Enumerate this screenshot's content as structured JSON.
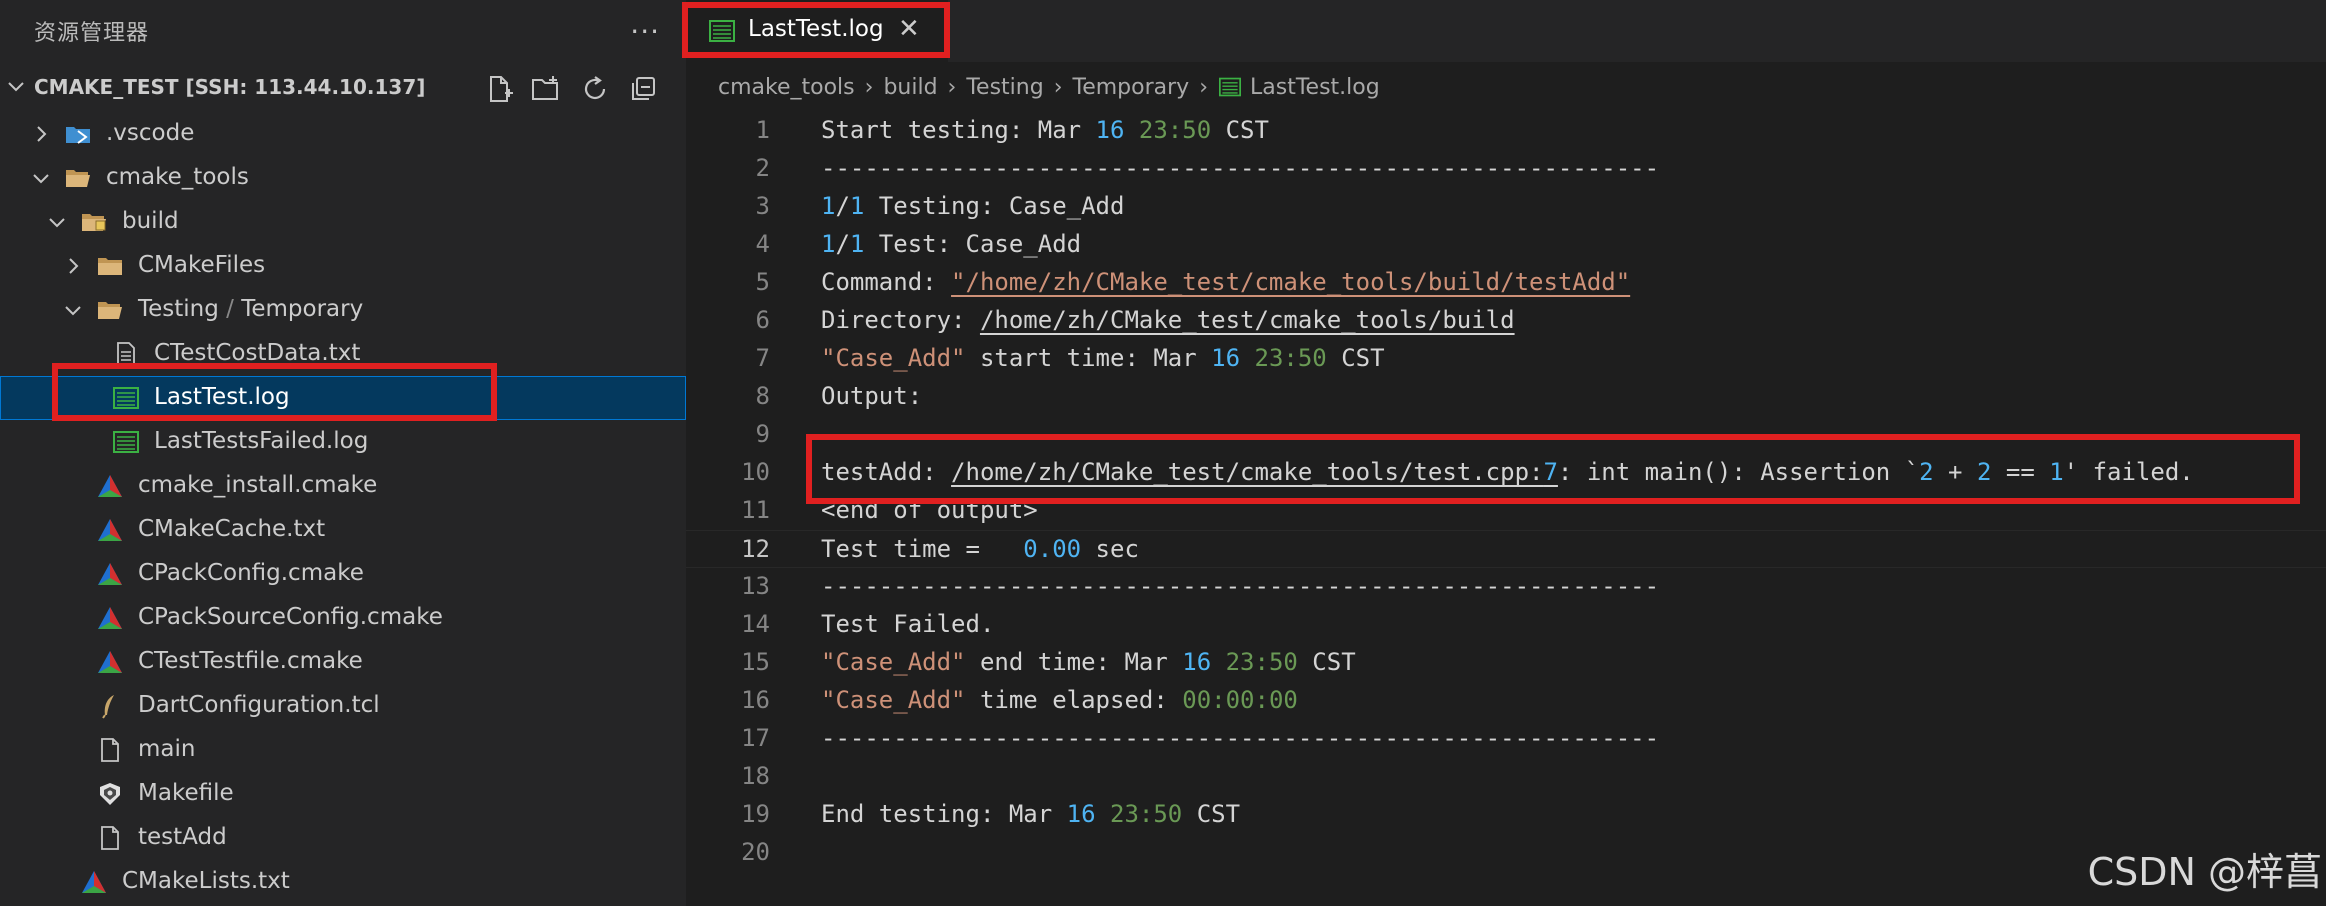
{
  "explorer": {
    "title": "资源管理器",
    "more": "···",
    "workspace": "CMAKE_TEST [SSH: 113.44.10.137]",
    "tree": [
      {
        "label": ".vscode"
      },
      {
        "label": "cmake_tools"
      },
      {
        "label": "build"
      },
      {
        "label": "CMakeFiles"
      },
      {
        "label_a": "Testing",
        "label_b": "Temporary"
      },
      {
        "label": "CTestCostData.txt"
      },
      {
        "label": "LastTest.log"
      },
      {
        "label": "LastTestsFailed.log"
      },
      {
        "label": "cmake_install.cmake"
      },
      {
        "label": "CMakeCache.txt"
      },
      {
        "label": "CPackConfig.cmake"
      },
      {
        "label": "CPackSourceConfig.cmake"
      },
      {
        "label": "CTestTestfile.cmake"
      },
      {
        "label": "DartConfiguration.tcl"
      },
      {
        "label": "main"
      },
      {
        "label": "Makefile"
      },
      {
        "label": "testAdd"
      },
      {
        "label": "CMakeLists.txt"
      }
    ]
  },
  "tab": {
    "label": "LastTest.log",
    "close": "✕"
  },
  "breadcrumb": [
    "cmake_tools",
    "build",
    "Testing",
    "Temporary",
    "LastTest.log"
  ],
  "editor": {
    "line_numbers": [
      "1",
      "2",
      "3",
      "4",
      "5",
      "6",
      "7",
      "8",
      "9",
      "10",
      "11",
      "12",
      "13",
      "14",
      "15",
      "16",
      "17",
      "18",
      "19",
      "20"
    ],
    "l1": {
      "a": "Start testing: Mar ",
      "b": "16",
      "c": " ",
      "d": "23:50",
      "e": " CST"
    },
    "dashes": "----------------------------------------------------------",
    "l3": {
      "a": "1",
      "b": "/",
      "c": "1",
      "d": " Testing: Case_Add"
    },
    "l4": {
      "a": "1",
      "b": "/",
      "c": "1",
      "d": " Test: Case_Add"
    },
    "l5": {
      "a": "Command: ",
      "b": "\"/home/zh/CMake_test/cmake_tools/build/testAdd\""
    },
    "l6": {
      "a": "Directory: ",
      "b": "/home/zh/CMake_test/cmake_tools/build"
    },
    "l7": {
      "a": "\"Case_Add\"",
      "b": " start time: Mar ",
      "c": "16",
      "d": " ",
      "e": "23:50",
      "f": " CST"
    },
    "l8": "Output:",
    "l10": {
      "a": "testAdd: ",
      "b": "/home/zh/CMake_test/cmake_tools/test.cpp:",
      "c": "7",
      "d": ": int main(): Assertion `",
      "e": "2",
      "f": " + ",
      "g": "2",
      "h": " == ",
      "i": "1",
      "j": "' failed."
    },
    "l11": "<end of output>",
    "l12": {
      "a": "Test time =   ",
      "b": "0.00",
      "c": " sec"
    },
    "l14": "Test Failed.",
    "l15": {
      "a": "\"Case_Add\"",
      "b": " end time: Mar ",
      "c": "16",
      "d": " ",
      "e": "23:50",
      "f": " CST"
    },
    "l16": {
      "a": "\"Case_Add\"",
      "b": " time elapsed: ",
      "c": "00:00:00"
    },
    "l19": {
      "a": "End testing: Mar ",
      "b": "16",
      "c": " ",
      "d": "23:50",
      "e": " CST"
    }
  },
  "watermark": "CSDN @梓菖",
  "colors": {
    "selection": "#04395e",
    "annotation": "#e02020",
    "number": "#4fb4f3",
    "string": "#ce9178",
    "time": "#6a9955"
  }
}
